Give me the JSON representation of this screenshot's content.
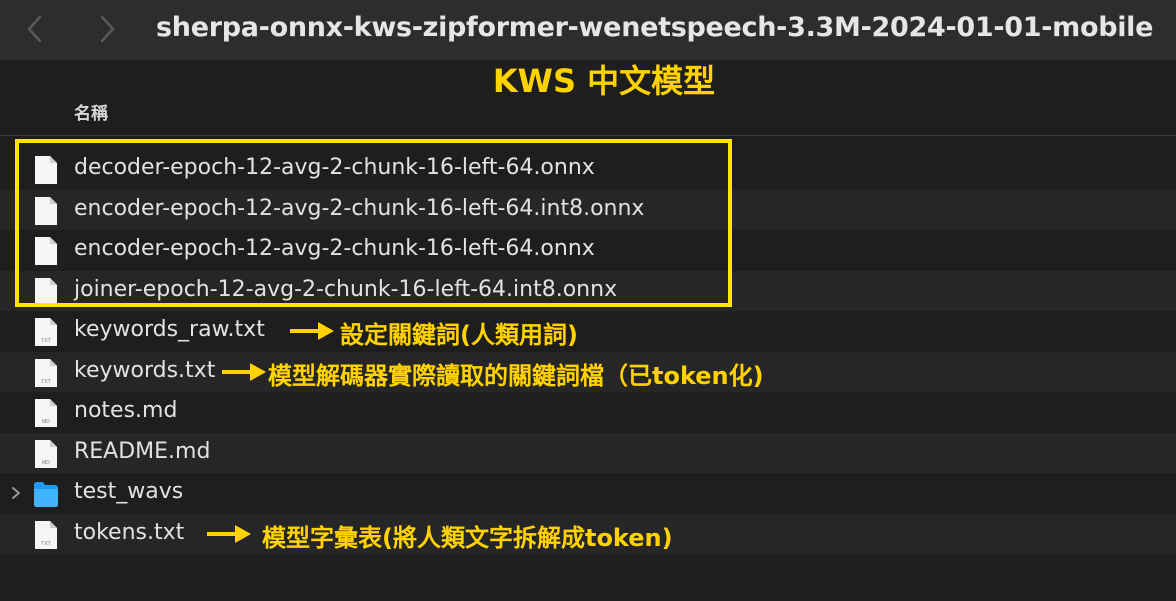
{
  "toolbar": {
    "back_icon": "chevron-left-icon",
    "forward_icon": "chevron-right-icon",
    "title": "sherpa-onnx-kws-zipformer-wenetspeech-3.3M-2024-01-01-mobile"
  },
  "overlay": {
    "title": "KWS 中文模型",
    "highlight_color": "#ffe500",
    "annotation_color": "#ffd200"
  },
  "list": {
    "column_header": "名稱",
    "items": [
      {
        "name": "decoder-epoch-12-avg-2-chunk-16-left-64.onnx",
        "kind": "file"
      },
      {
        "name": "encoder-epoch-12-avg-2-chunk-16-left-64.int8.onnx",
        "kind": "file"
      },
      {
        "name": "encoder-epoch-12-avg-2-chunk-16-left-64.onnx",
        "kind": "file"
      },
      {
        "name": "joiner-epoch-12-avg-2-chunk-16-left-64.int8.onnx",
        "kind": "file"
      },
      {
        "name": "keywords_raw.txt",
        "kind": "txt",
        "annotation": "設定關鍵詞(人類用詞)"
      },
      {
        "name": "keywords.txt",
        "kind": "txt",
        "annotation": "模型解碼器實際讀取的關鍵詞檔（已token化)"
      },
      {
        "name": "notes.md",
        "kind": "md"
      },
      {
        "name": "README.md",
        "kind": "md"
      },
      {
        "name": "test_wavs",
        "kind": "folder"
      },
      {
        "name": "tokens.txt",
        "kind": "txt",
        "annotation": "模型字彙表(將人類文字拆解成token)"
      }
    ],
    "badges": {
      "txt": "TXT",
      "md": "MD"
    }
  }
}
